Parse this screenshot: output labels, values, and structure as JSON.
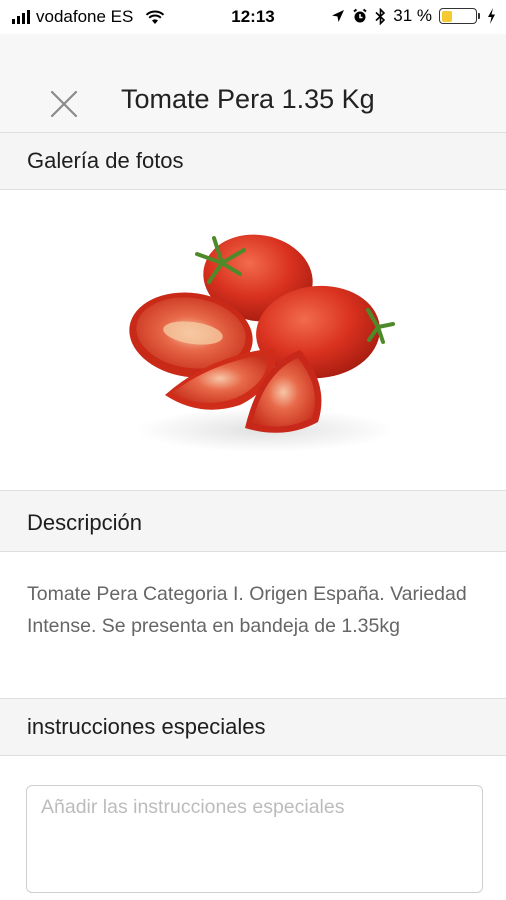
{
  "status_bar": {
    "carrier": "vodafone ES",
    "time": "12:13",
    "battery_percent": "31 %",
    "battery_level": 0.31
  },
  "header": {
    "title": "Tomate Pera 1.35 Kg",
    "close_icon": "close-icon"
  },
  "sections": {
    "gallery": "Galería de fotos",
    "description": "Descripción",
    "instructions": "instrucciones especiales"
  },
  "description_text": "Tomate Pera Categoria I. Origen España. Variedad Intense. Se presenta en bandeja de 1.35kg",
  "instructions_input": {
    "value": "",
    "placeholder": "Añadir las instrucciones especiales"
  },
  "colors": {
    "battery_fill": "#f5c932",
    "tomato_red": "#d9311f"
  }
}
